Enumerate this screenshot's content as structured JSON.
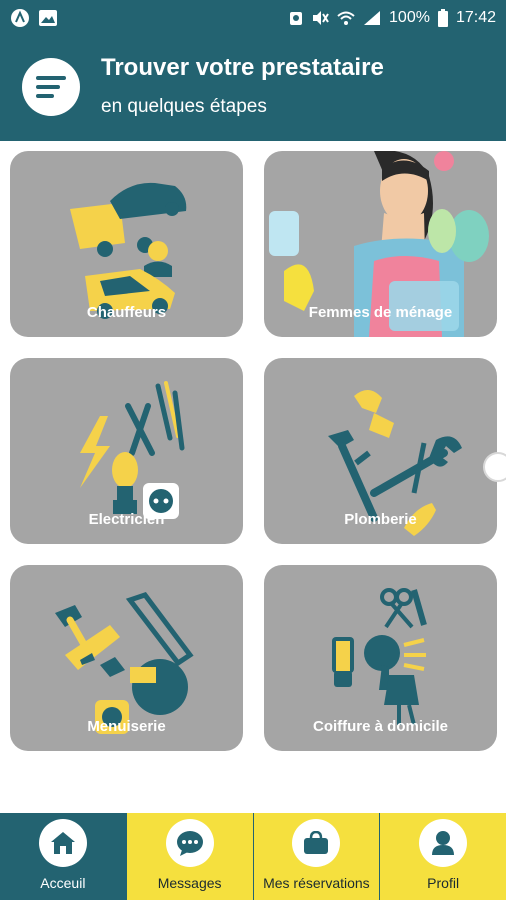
{
  "status_bar": {
    "battery": "100%",
    "time": "17:42"
  },
  "header": {
    "title": "Trouver votre prestataire",
    "subtitle": "en quelques étapes"
  },
  "categories": [
    {
      "label": "Chauffeurs",
      "icon": "car-icon"
    },
    {
      "label": "Femmes de ménage",
      "icon": "cleaning-lady-icon"
    },
    {
      "label": "Electricien",
      "icon": "electric-tools-icon"
    },
    {
      "label": "Plomberie",
      "icon": "plumbing-tools-icon"
    },
    {
      "label": "Menuiserie",
      "icon": "carpentry-tools-icon"
    },
    {
      "label": "Coiffure à domicile",
      "icon": "hair-tools-icon"
    }
  ],
  "bottom_nav": [
    {
      "label": "Acceuil",
      "icon": "home-icon",
      "active": true
    },
    {
      "label": "Messages",
      "icon": "chat-icon",
      "active": false
    },
    {
      "label": "Mes réservations",
      "icon": "bag-icon",
      "active": false
    },
    {
      "label": "Profil",
      "icon": "user-icon",
      "active": false
    }
  ],
  "colors": {
    "primary": "#236371",
    "accent": "#f5e03e",
    "card": "#a5a5a5"
  }
}
